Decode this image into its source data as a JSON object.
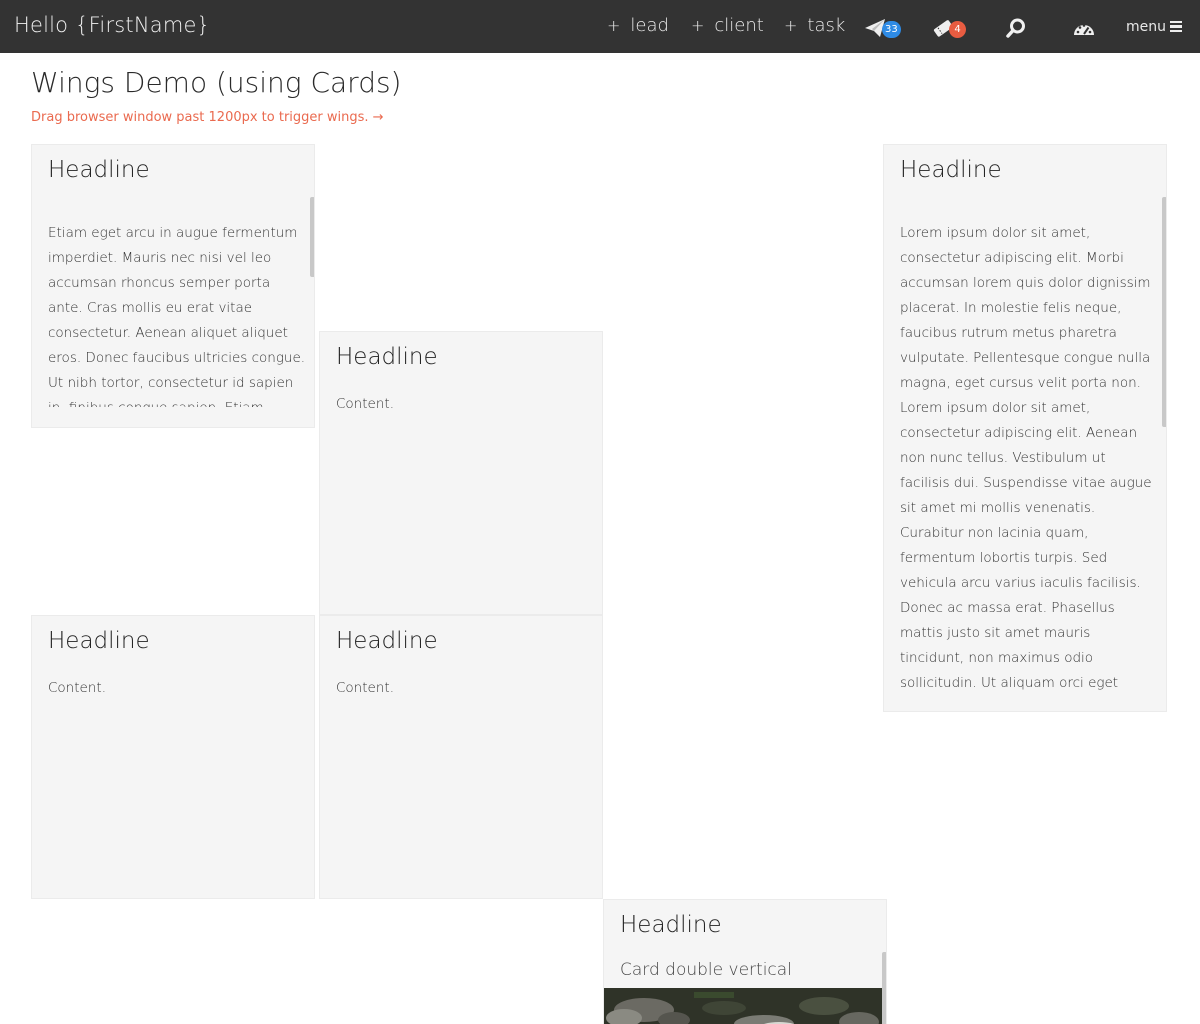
{
  "header": {
    "greeting": "Hello {FirstName}",
    "add_lead": "lead",
    "add_client": "client",
    "add_task": "task",
    "messages_badge": "33",
    "tickets_badge": "4",
    "menu_label": "menu",
    "icons": [
      "plus-icon",
      "paper-plane-icon",
      "ticket-icon",
      "search-icon",
      "dashboard-icon",
      "hamburger-icon"
    ]
  },
  "page": {
    "title": "Wings Demo (using Cards)",
    "hint": "Drag browser window past 1200px to trigger wings. →",
    "hint_color": "#ea6a4f"
  },
  "cards": {
    "card1": {
      "headline": "Headline",
      "body": "Etiam eget arcu in augue fermentum imperdiet. Mauris nec nisi vel leo accumsan rhoncus semper porta ante. Cras mollis eu erat vitae consectetur. Aenean aliquet aliquet eros. Donec faucibus ultricies congue. Ut nibh tortor, consectetur id sapien in, finibus congue sapien. Etiam ullamcorper mi id"
    },
    "card2": {
      "headline": "Headline",
      "body": "Content."
    },
    "card3": {
      "headline": "Headline",
      "body": "Content."
    },
    "card4": {
      "headline": "Headline",
      "body": "Content."
    },
    "card5": {
      "headline": "Headline",
      "body": "Lorem ipsum dolor sit amet, consectetur adipiscing elit. Morbi accumsan lorem quis dolor dignissim placerat. In molestie felis neque, faucibus rutrum metus pharetra vulputate. Pellentesque congue nulla magna, eget cursus velit porta non. Lorem ipsum dolor sit amet, consectetur adipiscing elit. Aenean non nunc tellus. Vestibulum ut facilisis dui. Suspendisse vitae augue sit amet mi mollis venenatis. Curabitur non lacinia quam, fermentum lobortis turpis. Sed vehicula arcu varius iaculis facilisis. Donec ac massa erat. Phasellus mattis justo sit amet mauris tincidunt, non maximus odio sollicitudin. Ut aliquam orci eget tincidunt maximus."
    },
    "card6": {
      "headline": "Headline",
      "subtitle": "Card double vertical"
    }
  },
  "colors": {
    "topbar": "#333333",
    "card_bg": "#f5f5f5",
    "badge_blue": "#2e8be6",
    "badge_red": "#e85c41"
  }
}
